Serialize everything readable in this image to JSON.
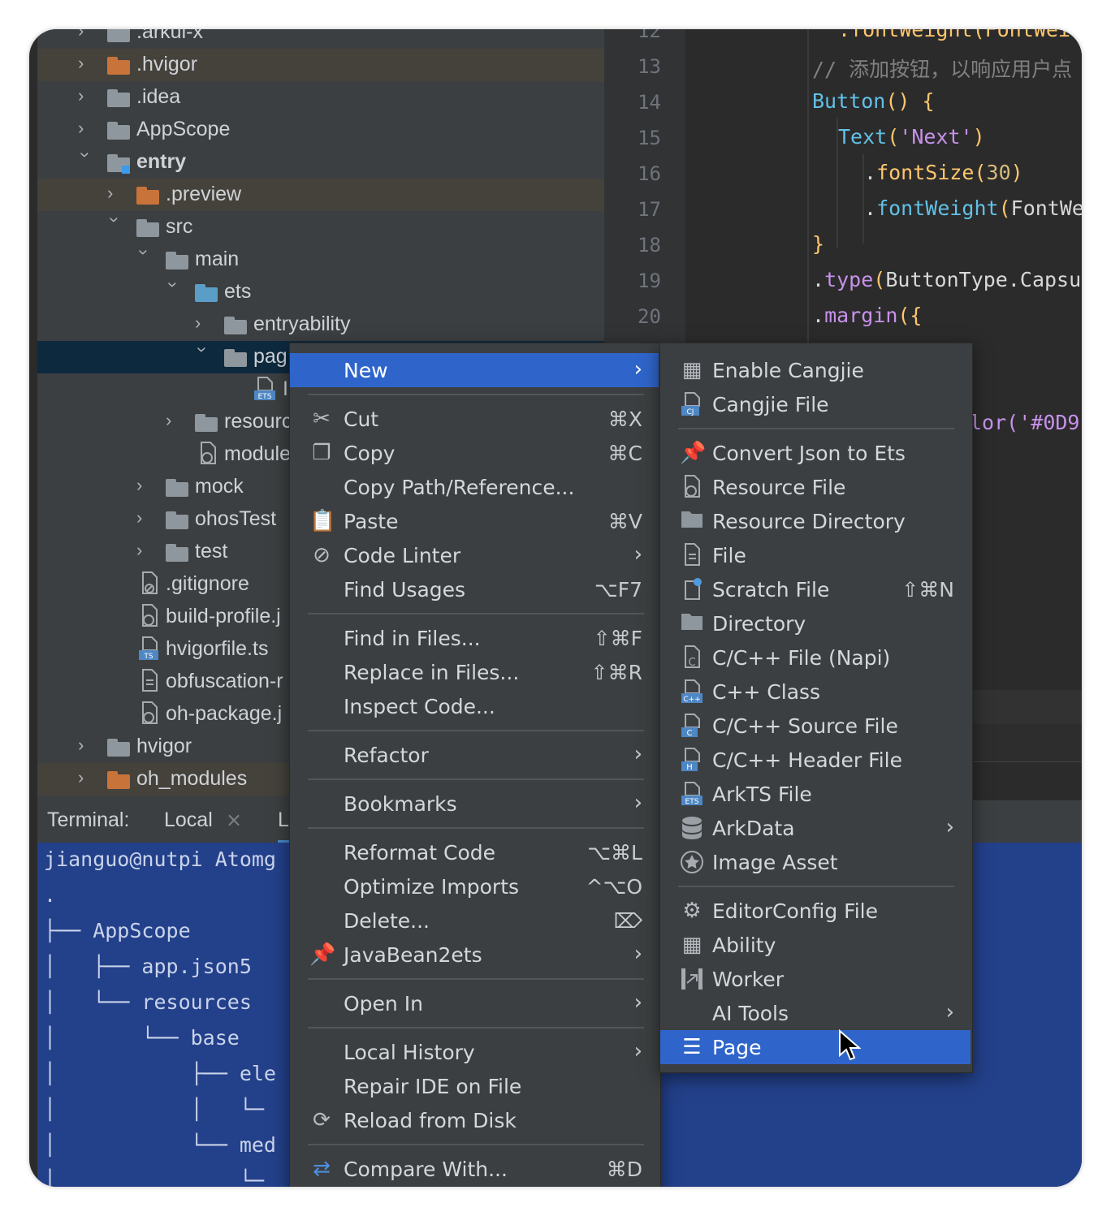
{
  "tree": {
    "items": [
      {
        "label": ".arkui-x"
      },
      {
        "label": ".hvigor"
      },
      {
        "label": ".idea"
      },
      {
        "label": "AppScope"
      },
      {
        "label": "entry"
      },
      {
        "label": ".preview"
      },
      {
        "label": "src"
      },
      {
        "label": "main"
      },
      {
        "label": "ets"
      },
      {
        "label": "entryability"
      },
      {
        "label": "pag"
      },
      {
        "label": "I"
      },
      {
        "label": "resourc"
      },
      {
        "label": "module"
      },
      {
        "label": "mock"
      },
      {
        "label": "ohosTest"
      },
      {
        "label": "test"
      },
      {
        "label": ".gitignore"
      },
      {
        "label": "build-profile.j"
      },
      {
        "label": "hvigorfile.ts"
      },
      {
        "label": "obfuscation-r"
      },
      {
        "label": "oh-package.j"
      },
      {
        "label": "hvigor"
      },
      {
        "label": "oh_modules"
      }
    ]
  },
  "editor": {
    "line_numbers": [
      "12",
      "13",
      "14",
      "15",
      "16",
      "17",
      "18",
      "19",
      "20"
    ],
    "code": {
      "l12": ".fontWeight(FontWei",
      "l13": "// 添加按钮，以响应用户点",
      "l14a": "Button",
      "l14b": "() {",
      "l15a": "Text",
      "l15b": "(",
      "l15c": "'Next'",
      "l15d": ")",
      "l16a": ".",
      "l16b": "fontSize",
      "l16c": "(",
      "l16d": "30",
      "l16e": ")",
      "l17a": ".",
      "l17b": "fontWeight",
      "l17c": "(",
      "l17d": "FontWe",
      "l18": "}",
      "l19a": ".",
      "l19b": "type",
      "l19c": "(",
      "l19d": "ButtonType.Capsu",
      "l20a": ".",
      "l20b": "margin",
      "l20c": "({",
      "l22a": "lor(",
      "l22b": "'#0D9"
    }
  },
  "terminal": {
    "label": "Terminal:",
    "tab_local": "Local",
    "tab_close": "×",
    "tab_next": "L",
    "lines": [
      "jianguo@nutpi Atomg",
      ".",
      "├── AppScope",
      "│   ├── app.json5",
      "│   └── resources",
      "│       └── base",
      "│           ├── ele",
      "│           │   └─",
      "│           └── med",
      "│               └─"
    ]
  },
  "context_menu": {
    "items": [
      {
        "label": "New",
        "shortcut": "",
        "submenu": true
      },
      {
        "label": "Cut",
        "shortcut": "⌘X"
      },
      {
        "label": "Copy",
        "shortcut": "⌘C"
      },
      {
        "label": "Copy Path/Reference...",
        "shortcut": ""
      },
      {
        "label": "Paste",
        "shortcut": "⌘V"
      },
      {
        "label": "Code Linter",
        "shortcut": "",
        "submenu": true
      },
      {
        "label": "Find Usages",
        "shortcut": "⌥F7"
      },
      {
        "label": "Find in Files...",
        "shortcut": "⇧⌘F"
      },
      {
        "label": "Replace in Files...",
        "shortcut": "⇧⌘R"
      },
      {
        "label": "Inspect Code...",
        "shortcut": ""
      },
      {
        "label": "Refactor",
        "shortcut": "",
        "submenu": true
      },
      {
        "label": "Bookmarks",
        "shortcut": "",
        "submenu": true
      },
      {
        "label": "Reformat Code",
        "shortcut": "⌥⌘L"
      },
      {
        "label": "Optimize Imports",
        "shortcut": "^⌥O"
      },
      {
        "label": "Delete...",
        "shortcut": "⌦"
      },
      {
        "label": "JavaBean2ets",
        "shortcut": "",
        "submenu": true
      },
      {
        "label": "Open In",
        "shortcut": "",
        "submenu": true
      },
      {
        "label": "Local History",
        "shortcut": "",
        "submenu": true
      },
      {
        "label": "Repair IDE on File",
        "shortcut": ""
      },
      {
        "label": "Reload from Disk",
        "shortcut": ""
      },
      {
        "label": "Compare With...",
        "shortcut": "⌘D"
      }
    ]
  },
  "new_submenu": {
    "items": [
      {
        "label": "Enable Cangjie"
      },
      {
        "label": "Cangjie File"
      },
      {
        "label": "Convert Json to Ets"
      },
      {
        "label": "Resource File"
      },
      {
        "label": "Resource Directory"
      },
      {
        "label": "File"
      },
      {
        "label": "Scratch File",
        "shortcut": "⇧⌘N"
      },
      {
        "label": "Directory"
      },
      {
        "label": "C/C++ File (Napi)"
      },
      {
        "label": "C++ Class"
      },
      {
        "label": "C/C++ Source File"
      },
      {
        "label": "C/C++ Header File"
      },
      {
        "label": "ArkTS File"
      },
      {
        "label": "ArkData",
        "submenu": true
      },
      {
        "label": "Image Asset"
      },
      {
        "label": "EditorConfig File"
      },
      {
        "label": "Ability"
      },
      {
        "label": "Worker"
      },
      {
        "label": "AI Tools",
        "submenu": true
      },
      {
        "label": "Page"
      }
    ],
    "icon_badges": {
      "cj": "CJ",
      "cpp": "C++",
      "c": "C",
      "h": "H",
      "ets": "ETS",
      "ts": "TS"
    }
  },
  "colors": {
    "selection": "#2f65ca",
    "menu_bg": "#3c3f41",
    "terminal_bg": "#23408a"
  }
}
